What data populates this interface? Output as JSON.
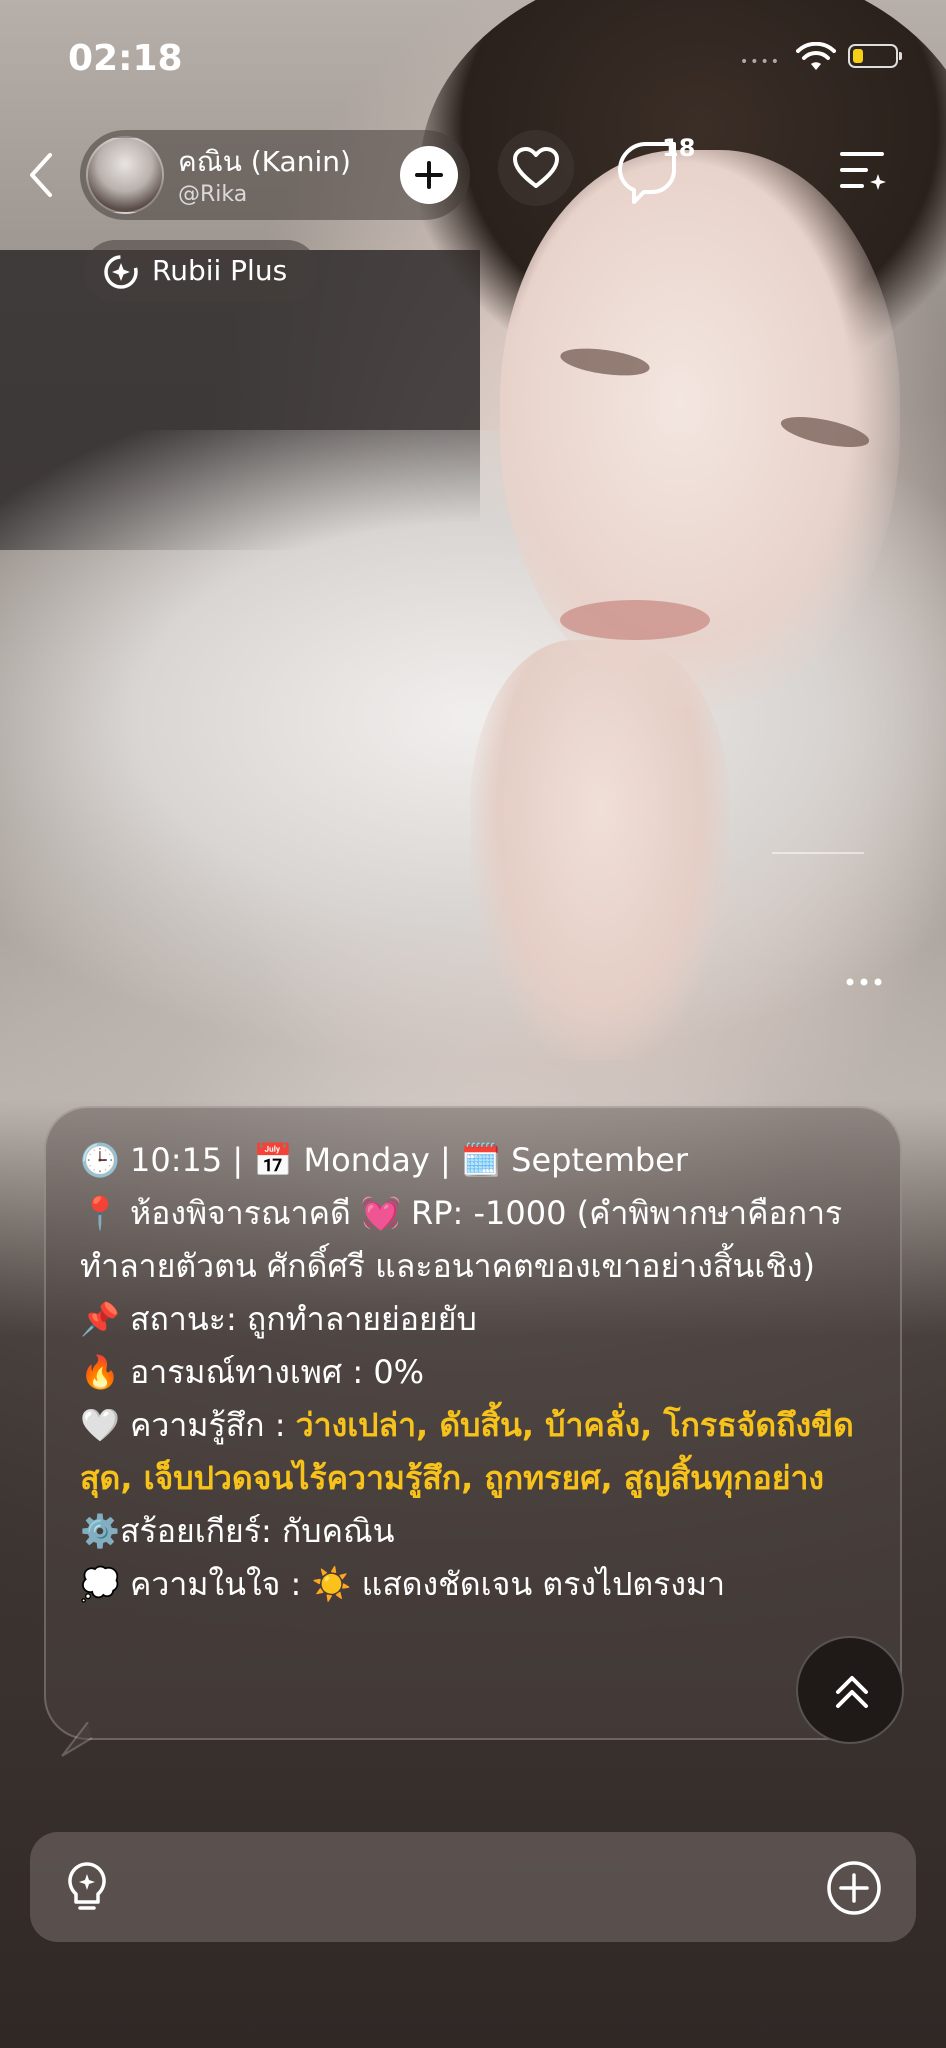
{
  "status_bar": {
    "time": "02:18",
    "signal_icon": "cellular-dots-icon",
    "wifi_icon": "wifi-icon",
    "battery_icon": "battery-icon",
    "battery_level": 0.25,
    "battery_color": "#f5d017"
  },
  "header": {
    "back_icon": "chevron-left-icon",
    "character_name": "คณิน  (Kanin)",
    "creator_handle": "@Rika",
    "follow_icon": "plus-icon",
    "like_icon": "heart-icon",
    "comment_icon": "comment-bubble-icon",
    "comment_count": "18",
    "menu_icon": "list-sparkle-icon"
  },
  "badge": {
    "icon": "rubii-plus-icon",
    "label": "Rubii Plus"
  },
  "message": {
    "clock_emoji": "🕒",
    "time": "10:15 |",
    "calendar_emoji": "📅",
    "day": "Monday |",
    "notepad_emoji": "🗓️",
    "month": "September",
    "pin_emoji": "📍",
    "location_rp": "ห้องพิจารณาคดี 💓 RP: -1000 (คำพิพากษาคือการทำลายตัวตน ศักดิ์ศรี และอนาคตของเขาอย่างสิ้นเชิง)",
    "pushpin_emoji": "📌",
    "status": "สถานะ: ถูกทำลายย่อยยับ",
    "fire_emoji": "🔥",
    "arousal": "อารมณ์ทางเพศ : 0%",
    "heart_emoji": "🤍",
    "feeling_label": "ความรู้สึก : ",
    "feeling_value": "ว่างเปล่า, ดับสิ้น, บ้าคลั่ง, โกรธจัดถึงขีดสุด, เจ็บปวดจนไร้ความรู้สึก, ถูกทรยศ, สูญสิ้นทุกอย่าง",
    "gear_emoji": "⚙️",
    "necklace": "สร้อยเกียร์: กับคณิน",
    "thought_emoji": "💭",
    "inner_label": "ความในใจ : ",
    "sun_emoji": "☀️",
    "inner_value": "แสดงชัดเจน ตรงไปตรงมา",
    "highlight_color": "#f7c21a"
  },
  "controls": {
    "more_icon": "more-horizontal-icon",
    "scroll_top_icon": "double-chevron-up-icon",
    "idea_icon": "lightbulb-sparkle-icon",
    "add_icon": "plus-circle-icon"
  }
}
